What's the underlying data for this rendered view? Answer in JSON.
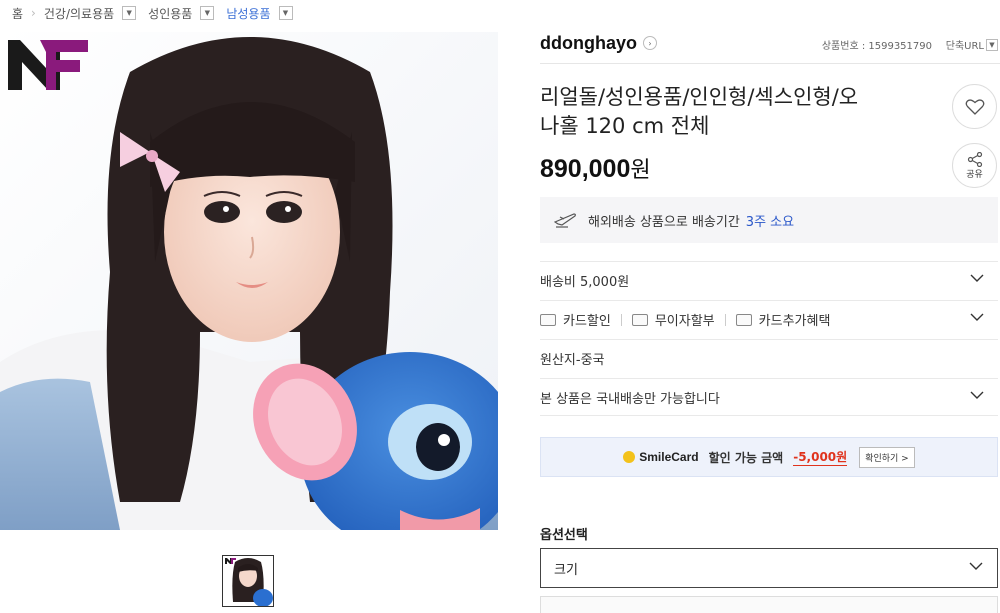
{
  "breadcrumb": {
    "home": "홈",
    "items": [
      "건강/의료용품",
      "성인용품",
      "남성용품"
    ]
  },
  "brand": {
    "logo_text": "NF",
    "accent": "#8a1a7c",
    "dark": "#1a1a1a"
  },
  "seller": {
    "name": "ddonghayo",
    "product_no_label": "상품번호 : 1599351790",
    "short_url_label": "단축URL"
  },
  "product": {
    "title_line1": "리얼돌/성인용품/인인형/섹스인형/오",
    "title_line2": "나홀 120 cm 전체",
    "price_number": "890,000",
    "price_unit": "원"
  },
  "actions": {
    "share_label": "공유"
  },
  "shipping": {
    "overseas_text": "해외배송 상품으로 배송기간",
    "duration": "3주 소요",
    "fee_text": "배송비 5,000원",
    "origin_text": "원산지-중국",
    "domestic_only_text": "본 상품은 국내배송만 가능합니다"
  },
  "benefits": [
    "카드할인",
    "무이자할부",
    "카드추가혜택"
  ],
  "smile_card": {
    "brand": "SmileCard",
    "label": "할인 가능 금액",
    "amount": "-5,000원",
    "check_button": "확인하기 >"
  },
  "options": {
    "title": "옵션선택",
    "selected": "크기"
  },
  "colors": {
    "accent_blue": "#2a57c9",
    "discount_red": "#e0331d",
    "smile_yellow": "#f3c21b"
  }
}
